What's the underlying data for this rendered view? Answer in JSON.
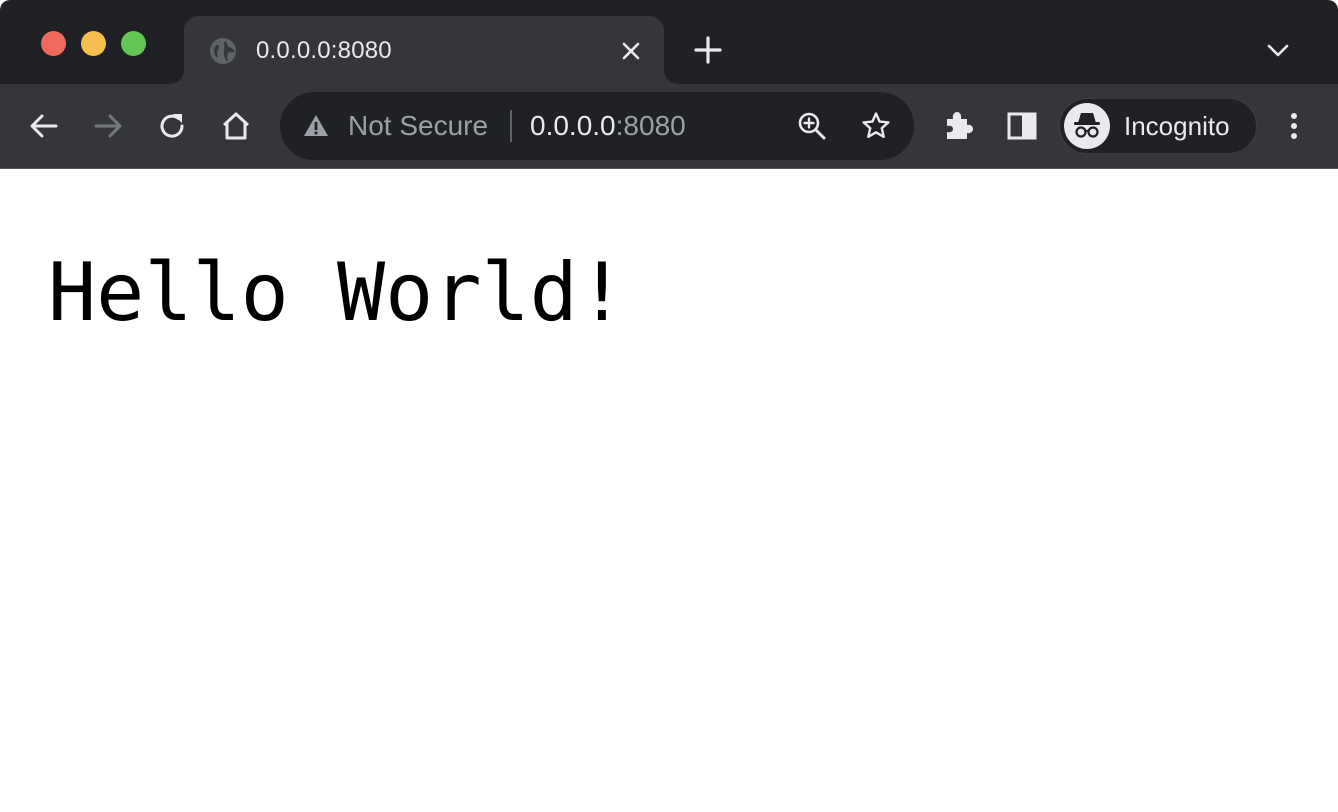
{
  "browser": {
    "tab": {
      "title": "0.0.0.0:8080",
      "favicon": "globe-icon"
    },
    "toolbar": {
      "back_icon": "arrow-left-icon",
      "forward_icon": "arrow-right-icon",
      "reload_icon": "reload-icon",
      "home_icon": "home-icon",
      "extensions_icon": "puzzle-icon",
      "side_panel_icon": "side-panel-icon",
      "menu_icon": "three-dots-vertical-icon"
    },
    "omnibox": {
      "security_label": "Not Secure",
      "url_host": "0.0.0.0",
      "url_port": ":8080",
      "zoom_icon": "zoom-in-icon",
      "bookmark_icon": "star-icon"
    },
    "profile": {
      "label": "Incognito",
      "icon": "incognito-icon"
    }
  },
  "page": {
    "heading": "Hello World!"
  },
  "colors": {
    "titlebar_bg": "#202124",
    "toolbar_bg": "#35363a",
    "omnibox_bg": "#202124",
    "text_primary": "#e8eaed",
    "text_secondary": "#9aa0a6",
    "traffic_close": "#ee6a5f",
    "traffic_minimize": "#f5be4f",
    "traffic_zoom": "#62c554"
  }
}
